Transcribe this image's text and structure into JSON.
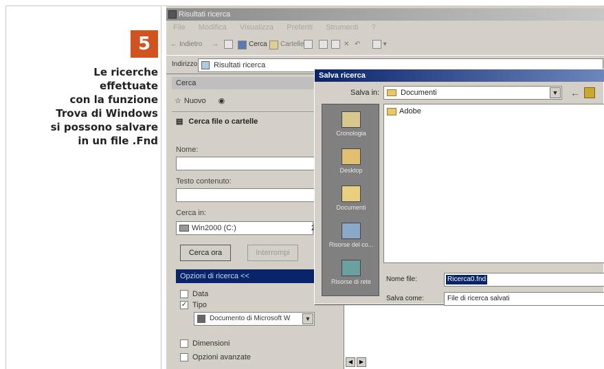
{
  "article": {
    "step_number": "5",
    "caption_lines": [
      "Le ricerche",
      "effettuate",
      "con la funzione",
      "Trova di Windows",
      "si possono salvare",
      "in un file .Fnd"
    ]
  },
  "window": {
    "title": "Risultati ricerca",
    "menu": [
      "File",
      "Modifica",
      "Visualizza",
      "Preferiti",
      "Strumenti",
      "?"
    ],
    "toolbar": {
      "back_label": "Indietro",
      "search_label": "Cerca",
      "folders_label": "Cartelle"
    },
    "address": {
      "label": "Indirizzo",
      "value": "Risultati ricerca"
    }
  },
  "search_pane": {
    "header": "Cerca",
    "new_label": "Nuovo",
    "title": "Cerca file o cartelle",
    "name_label": "Nome:",
    "text_label": "Testo contenuto:",
    "lookin_label": "Cerca in:",
    "lookin_value": "Win2000 (C:)",
    "lookin_partial": "2",
    "search_button": "Cerca ora",
    "stop_button": "Interrompi",
    "options_header": "Opzioni di ricerca <<",
    "options": [
      {
        "label": "Data",
        "checked": false
      },
      {
        "label": "Tipo",
        "checked": true
      },
      {
        "label": "Dimensioni",
        "checked": false
      },
      {
        "label": "Opzioni avanzate",
        "checked": false
      }
    ],
    "type_value": "Documento di Microsoft W"
  },
  "save_dialog": {
    "title": "Salva ricerca",
    "save_in_label": "Salva in:",
    "save_in_value": "Documenti",
    "places": [
      "Cronologia",
      "Desktop",
      "Documenti",
      "Risorse del co...",
      "Risorse di rete"
    ],
    "files": [
      "Adobe"
    ],
    "filename_label": "Nome file:",
    "filename_value": "Ricerca0.fnd",
    "filetype_label": "Salva come:",
    "filetype_value": "File di ricerca salvati"
  }
}
